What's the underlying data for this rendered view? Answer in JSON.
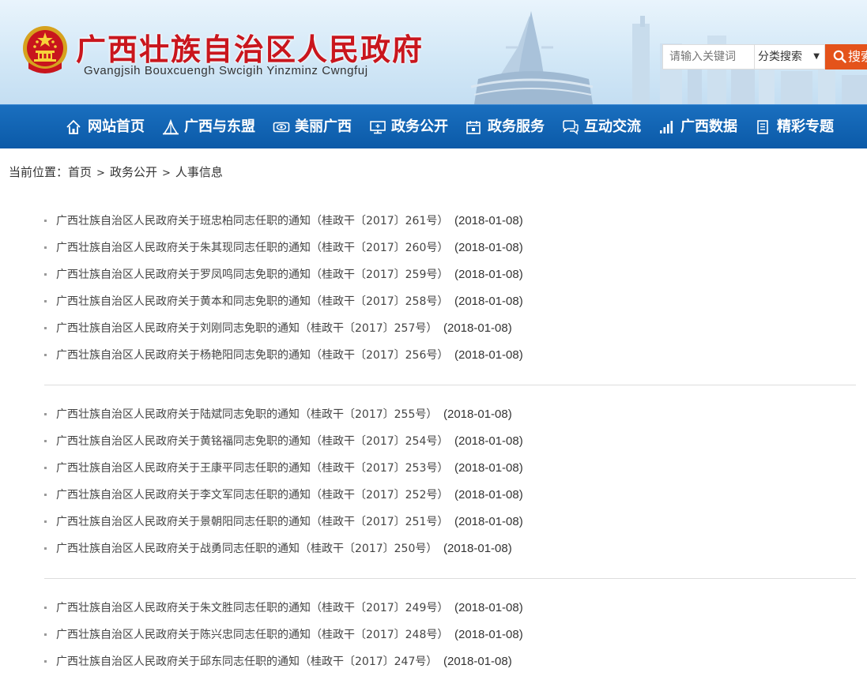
{
  "header": {
    "title": "广西壮族自治区人民政府",
    "subtitle": "Gvangjsih Bouxcuengh Swcigih Yinzminz Cwngfuj",
    "emblem_icon": "national-emblem-icon",
    "search": {
      "placeholder": "请输入关键词",
      "category_label": "分类搜索",
      "button_label": "搜索"
    }
  },
  "nav": {
    "items": [
      {
        "label": "网站首页",
        "icon": "home-icon"
      },
      {
        "label": "广西与东盟",
        "icon": "building-icon"
      },
      {
        "label": "美丽广西",
        "icon": "eye-icon"
      },
      {
        "label": "政务公开",
        "icon": "monitor-icon"
      },
      {
        "label": "政务服务",
        "icon": "calendar-icon"
      },
      {
        "label": "互动交流",
        "icon": "chat-icon"
      },
      {
        "label": "广西数据",
        "icon": "bar-chart-icon"
      },
      {
        "label": "精彩专题",
        "icon": "document-icon"
      }
    ]
  },
  "breadcrumb": {
    "prefix": "当前位置：",
    "items": [
      "首页",
      "政务公开",
      "人事信息"
    ],
    "separator": ">"
  },
  "groups": [
    [
      {
        "title": "广西壮族自治区人民政府关于班忠柏同志任职的通知（桂政干〔2017〕261号）",
        "date": "(2018-01-08)"
      },
      {
        "title": "广西壮族自治区人民政府关于朱其现同志任职的通知（桂政干〔2017〕260号）",
        "date": "(2018-01-08)"
      },
      {
        "title": "广西壮族自治区人民政府关于罗凤鸣同志免职的通知（桂政干〔2017〕259号）",
        "date": "(2018-01-08)"
      },
      {
        "title": "广西壮族自治区人民政府关于黄本和同志免职的通知（桂政干〔2017〕258号）",
        "date": "(2018-01-08)"
      },
      {
        "title": "广西壮族自治区人民政府关于刘刚同志免职的通知（桂政干〔2017〕257号）",
        "date": "(2018-01-08)"
      },
      {
        "title": "广西壮族自治区人民政府关于杨艳阳同志免职的通知（桂政干〔2017〕256号）",
        "date": "(2018-01-08)"
      }
    ],
    [
      {
        "title": "广西壮族自治区人民政府关于陆斌同志免职的通知（桂政干〔2017〕255号）",
        "date": "(2018-01-08)"
      },
      {
        "title": "广西壮族自治区人民政府关于黄铭福同志免职的通知（桂政干〔2017〕254号）",
        "date": "(2018-01-08)"
      },
      {
        "title": "广西壮族自治区人民政府关于王康平同志任职的通知（桂政干〔2017〕253号）",
        "date": "(2018-01-08)"
      },
      {
        "title": "广西壮族自治区人民政府关于李文军同志任职的通知（桂政干〔2017〕252号）",
        "date": "(2018-01-08)"
      },
      {
        "title": "广西壮族自治区人民政府关于景朝阳同志任职的通知（桂政干〔2017〕251号）",
        "date": "(2018-01-08)"
      },
      {
        "title": "广西壮族自治区人民政府关于战勇同志任职的通知（桂政干〔2017〕250号）",
        "date": "(2018-01-08)"
      }
    ],
    [
      {
        "title": "广西壮族自治区人民政府关于朱文胜同志任职的通知（桂政干〔2017〕249号）",
        "date": "(2018-01-08)"
      },
      {
        "title": "广西壮族自治区人民政府关于陈兴忠同志任职的通知（桂政干〔2017〕248号）",
        "date": "(2018-01-08)"
      },
      {
        "title": "广西壮族自治区人民政府关于邱东同志任职的通知（桂政干〔2017〕247号）",
        "date": "(2018-01-08)"
      }
    ]
  ],
  "colors": {
    "brand_red": "#c9161d",
    "nav_blue": "#0b5aa8",
    "search_orange": "#e4531b"
  }
}
